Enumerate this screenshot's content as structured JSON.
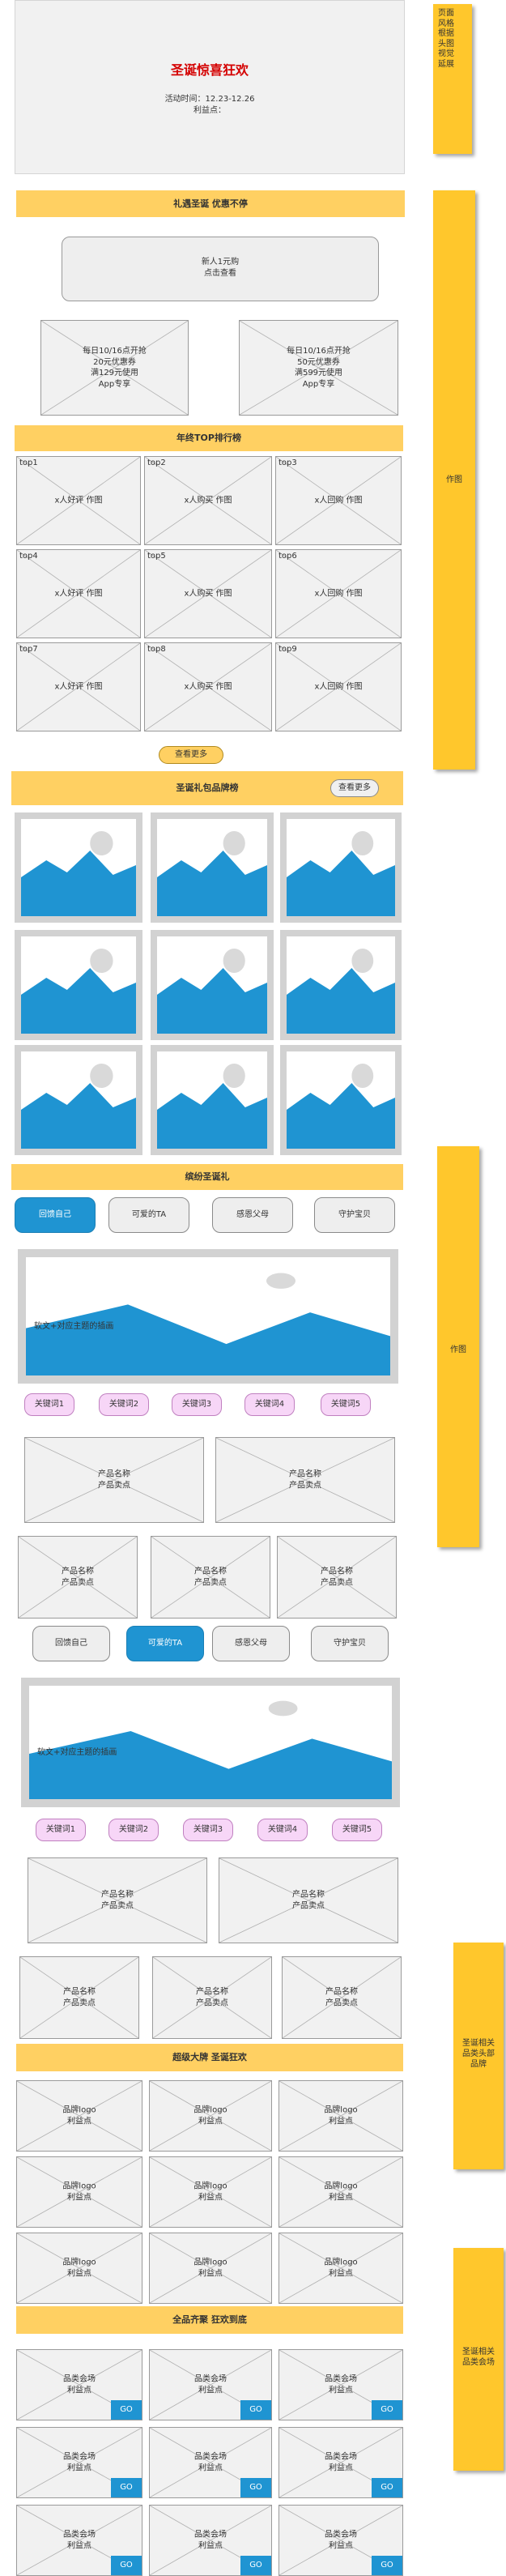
{
  "banner": {
    "title": "圣诞惊喜狂欢",
    "time": "活动时间：12.23-12.26",
    "benefit": "利益点："
  },
  "notes": {
    "style": [
      "页面",
      "风格",
      "根据",
      "头图",
      "视觉",
      "延展"
    ],
    "zuotu": "作图",
    "zuotu2": "作图",
    "brand": [
      "圣诞相关",
      "品类头部",
      "品牌"
    ],
    "cat": [
      "圣诞相关",
      "品类会场"
    ]
  },
  "gift": {
    "header": "礼遇圣诞 优惠不停",
    "newcomer": [
      "新人1元购",
      "点击查看"
    ],
    "coupons": [
      [
        "每日10/16点开抢",
        "20元优惠券",
        "满129元使用",
        "App专享"
      ],
      [
        "每日10/16点开抢",
        "50元优惠券",
        "满599元使用",
        "App专享"
      ]
    ]
  },
  "top": {
    "header": "年终TOP排行榜",
    "items": [
      {
        "tag": "top1",
        "text": "x人好评   作图"
      },
      {
        "tag": "top2",
        "text": "x人购买   作图"
      },
      {
        "tag": "top3",
        "text": "x人回购   作图"
      },
      {
        "tag": "top4",
        "text": "x人好评   作图"
      },
      {
        "tag": "top5",
        "text": "x人购买   作图"
      },
      {
        "tag": "top6",
        "text": "x人回购   作图"
      },
      {
        "tag": "top7",
        "text": "x人好评   作图"
      },
      {
        "tag": "top8",
        "text": "x人购买   作图"
      },
      {
        "tag": "top9",
        "text": "x人回购   作图"
      }
    ],
    "more": "查看更多"
  },
  "bags": {
    "header": "圣诞礼包品牌榜",
    "more": "查看更多"
  },
  "gifts": {
    "header": "缤纷圣诞礼",
    "tabs": [
      "回馈自己",
      "可爱的TA",
      "感恩父母",
      "守护宝贝"
    ],
    "soft_text": "软文+对应主题的插画",
    "keywords": [
      "关键词1",
      "关键词2",
      "关键词3",
      "关键词4",
      "关键词5"
    ],
    "product": [
      "产品名称",
      "产品卖点"
    ]
  },
  "brands": {
    "header": "超级大牌 圣诞狂欢",
    "item": [
      "品牌logo",
      "利益点"
    ]
  },
  "categories": {
    "header": "全品齐聚 狂欢到底",
    "item": [
      "品类会场",
      "利益点"
    ],
    "go": "GO"
  }
}
